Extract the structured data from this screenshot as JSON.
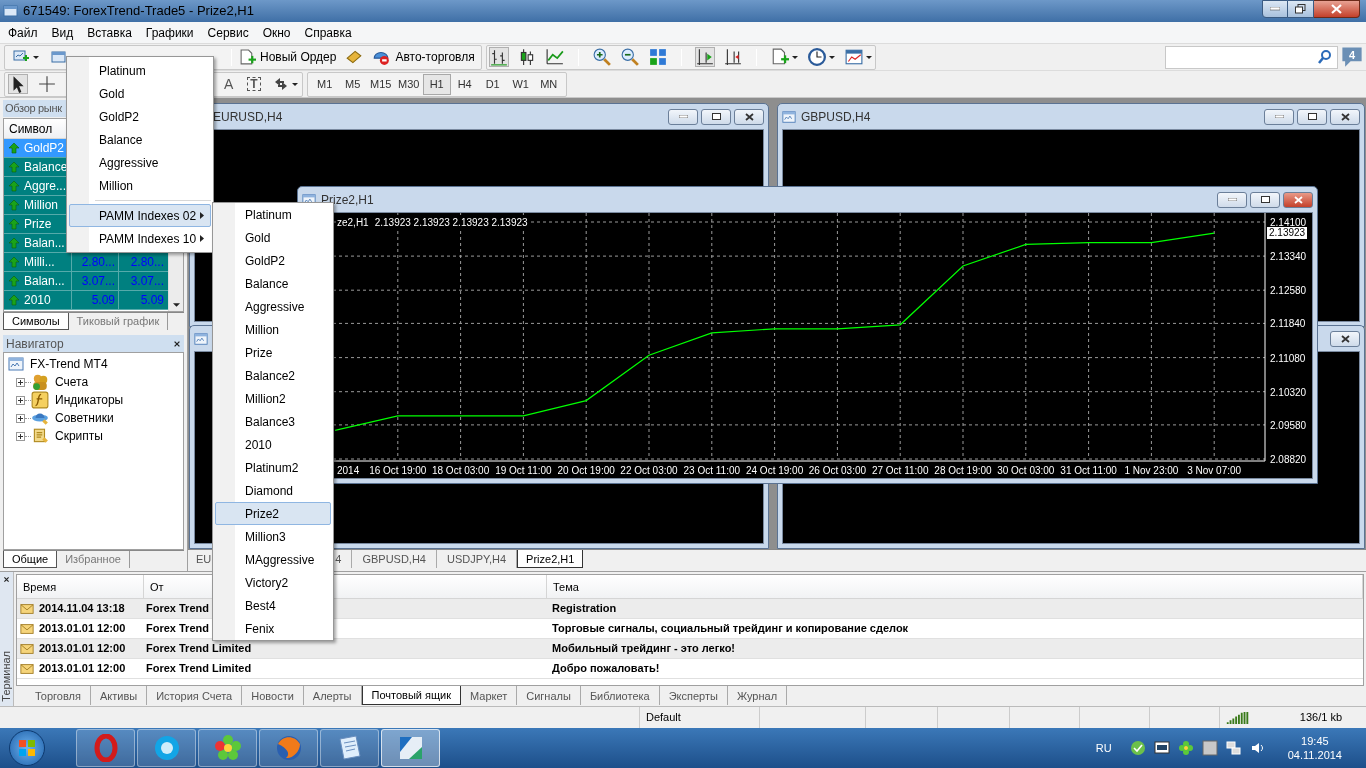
{
  "window": {
    "title": "671549: ForexTrend-Trade5 - Prize2,H1"
  },
  "menu_bar": [
    "Файл",
    "Вид",
    "Вставка",
    "Графики",
    "Сервис",
    "Окно",
    "Справка"
  ],
  "toolbar": {
    "new_order": "Новый Ордер",
    "auto_trading": "Авто-торговля",
    "notifications": "4"
  },
  "drawing_toolbar": {
    "text_tool": "A",
    "label_tool": "T"
  },
  "timeframes": [
    {
      "label": "M1",
      "selected": false
    },
    {
      "label": "M5",
      "selected": false
    },
    {
      "label": "M15",
      "selected": false
    },
    {
      "label": "M30",
      "selected": false
    },
    {
      "label": "H1",
      "selected": true
    },
    {
      "label": "H4",
      "selected": false
    },
    {
      "label": "D1",
      "selected": false
    },
    {
      "label": "W1",
      "selected": false
    },
    {
      "label": "MN",
      "selected": false
    }
  ],
  "market_watch": {
    "title": "Обзор рынк",
    "column": "Символ",
    "rows": [
      {
        "symbol": "GoldP2",
        "selected": true
      },
      {
        "symbol": "Balance",
        "selected": false
      },
      {
        "symbol": "Aggre...",
        "selected": false
      },
      {
        "symbol": "Million",
        "selected": false
      },
      {
        "symbol": "Prize",
        "selected": false
      },
      {
        "symbol": "Balan...",
        "selected": false
      },
      {
        "symbol": "Milli...",
        "bid": "2.80...",
        "ask": "2.80...",
        "selected": false
      },
      {
        "symbol": "Balan...",
        "bid": "3.07...",
        "ask": "3.07...",
        "selected": false
      },
      {
        "symbol": "2010",
        "bid": "5.09",
        "ask": "5.09",
        "selected": false
      }
    ],
    "tabs": [
      {
        "label": "Символы",
        "selected": true
      },
      {
        "label": "Тиковый график",
        "selected": false
      }
    ]
  },
  "navigator": {
    "title": "Навигатор",
    "root": "FX-Trend MT4",
    "children": [
      {
        "label": "Счета",
        "expanded": false
      },
      {
        "label": "Индикаторы",
        "expanded": false
      },
      {
        "label": "Советники",
        "expanded": false
      },
      {
        "label": "Скрипты",
        "expanded": false
      }
    ],
    "tabs": [
      {
        "label": "Общие",
        "selected": true
      },
      {
        "label": "Избранное",
        "selected": false
      }
    ]
  },
  "chart_windows": [
    {
      "title": "EURUSD,H4"
    },
    {
      "title": "GBPUSD,H4"
    },
    {
      "title": "Prize2,H1",
      "info": "ze2,H1",
      "quotes": "2.13923 2.13923 2.13923 2.13923",
      "current_price": "2.13923",
      "chart_data": {
        "type": "line",
        "categories": [
          "2014",
          "16 Oct 19:00",
          "18 Oct 03:00",
          "19 Oct 11:00",
          "20 Oct 19:00",
          "22 Oct 03:00",
          "23 Oct 11:00",
          "24 Oct 19:00",
          "26 Oct 03:00",
          "27 Oct 11:00",
          "28 Oct 19:00",
          "30 Oct 03:00",
          "31 Oct 11:00",
          "1 Nov 23:00",
          "3 Nov 07:00"
        ],
        "grid": true,
        "series": [
          {
            "color": "#00ff00",
            "values": [
              2.0946,
              2.0978,
              2.0978,
              2.0978,
              2.1012,
              2.1113,
              2.1163,
              2.1172,
              2.1172,
              2.1181,
              2.1312,
              2.136,
              2.1364,
              2.1364,
              2.1385
            ]
          }
        ],
        "ylim": [
          2.0882,
          2.141
        ],
        "yticks": [
          {
            "value": 2.141,
            "label": "2.14100"
          },
          {
            "value": 2.1334,
            "label": "2.13340"
          },
          {
            "value": 2.1258,
            "label": "2.12580"
          },
          {
            "value": 2.1184,
            "label": "2.11840"
          },
          {
            "value": 2.1108,
            "label": "2.11080"
          },
          {
            "value": 2.1032,
            "label": "2.10320"
          },
          {
            "value": 2.0958,
            "label": "2.09580"
          },
          {
            "value": 2.0882,
            "label": "2.08820"
          }
        ]
      }
    }
  ],
  "chart_tabs": [
    {
      "label": "EU",
      "selected": false
    },
    {
      "label": "4",
      "selected": false
    },
    {
      "label": "GBPUSD,H4",
      "selected": false
    },
    {
      "label": "USDJPY,H4",
      "selected": false
    },
    {
      "label": "Prize2,H1",
      "selected": true
    }
  ],
  "symbols_menu": {
    "items": [
      {
        "label": "Platinum",
        "kind": "item",
        "selected": false
      },
      {
        "label": "Gold",
        "kind": "item",
        "selected": false
      },
      {
        "label": "GoldP2",
        "kind": "item",
        "selected": false
      },
      {
        "label": "Balance",
        "kind": "item",
        "selected": false
      },
      {
        "label": "Aggressive",
        "kind": "item",
        "selected": false
      },
      {
        "label": "Million",
        "kind": "item",
        "selected": false
      },
      {
        "kind": "separator"
      },
      {
        "label": "PAMM Indexes 02",
        "kind": "submenu",
        "selected": true
      },
      {
        "label": "PAMM Indexes 10",
        "kind": "submenu",
        "selected": false
      }
    ]
  },
  "submenu": {
    "items": [
      {
        "label": "Platinum",
        "selected": false
      },
      {
        "label": "Gold",
        "selected": false
      },
      {
        "label": "GoldP2",
        "selected": false
      },
      {
        "label": "Balance",
        "selected": false
      },
      {
        "label": "Aggressive",
        "selected": false
      },
      {
        "label": "Million",
        "selected": false
      },
      {
        "label": "Prize",
        "selected": false
      },
      {
        "label": "Balance2",
        "selected": false
      },
      {
        "label": "Million2",
        "selected": false
      },
      {
        "label": "Balance3",
        "selected": false
      },
      {
        "label": "2010",
        "selected": false
      },
      {
        "label": "Platinum2",
        "selected": false
      },
      {
        "label": "Diamond",
        "selected": false
      },
      {
        "label": "Prize2",
        "selected": true
      },
      {
        "label": "Million3",
        "selected": false
      },
      {
        "label": "MAggressive",
        "selected": false
      },
      {
        "label": "Victory2",
        "selected": false
      },
      {
        "label": "Best4",
        "selected": false
      },
      {
        "label": "Fenix",
        "selected": false
      }
    ]
  },
  "terminal": {
    "title": "Терминал",
    "columns": [
      "Время",
      "От",
      "Тема"
    ],
    "rows": [
      {
        "time": "2014.11.04 13:18",
        "from": "Forex Trend",
        "subject": "Registration"
      },
      {
        "time": "2013.01.01 12:00",
        "from": "Forex Trend",
        "subject": "Торговые сигналы, социальный трейдинг и копирование сделок"
      },
      {
        "time": "2013.01.01 12:00",
        "from": "Forex Trend Limited",
        "subject": "Мобильный трейдинг - это легко!"
      },
      {
        "time": "2013.01.01 12:00",
        "from": "Forex Trend Limited",
        "subject": "Добро пожаловать!"
      }
    ],
    "tabs": [
      {
        "label": "Торговля",
        "selected": false
      },
      {
        "label": "Активы",
        "selected": false
      },
      {
        "label": "История Счета",
        "selected": false
      },
      {
        "label": "Новости",
        "selected": false
      },
      {
        "label": "Алерты",
        "selected": false
      },
      {
        "label": "Почтовый ящик",
        "selected": true
      },
      {
        "label": "Маркет",
        "selected": false
      },
      {
        "label": "Сигналы",
        "selected": false
      },
      {
        "label": "Библиотека",
        "selected": false
      },
      {
        "label": "Эксперты",
        "selected": false
      },
      {
        "label": "Журнал",
        "selected": false
      }
    ]
  },
  "status_bar": {
    "profile": "Default",
    "traffic": "136/1 kb"
  },
  "taskbar": {
    "language": "RU",
    "time": "19:45",
    "date": "04.11.2014"
  }
}
